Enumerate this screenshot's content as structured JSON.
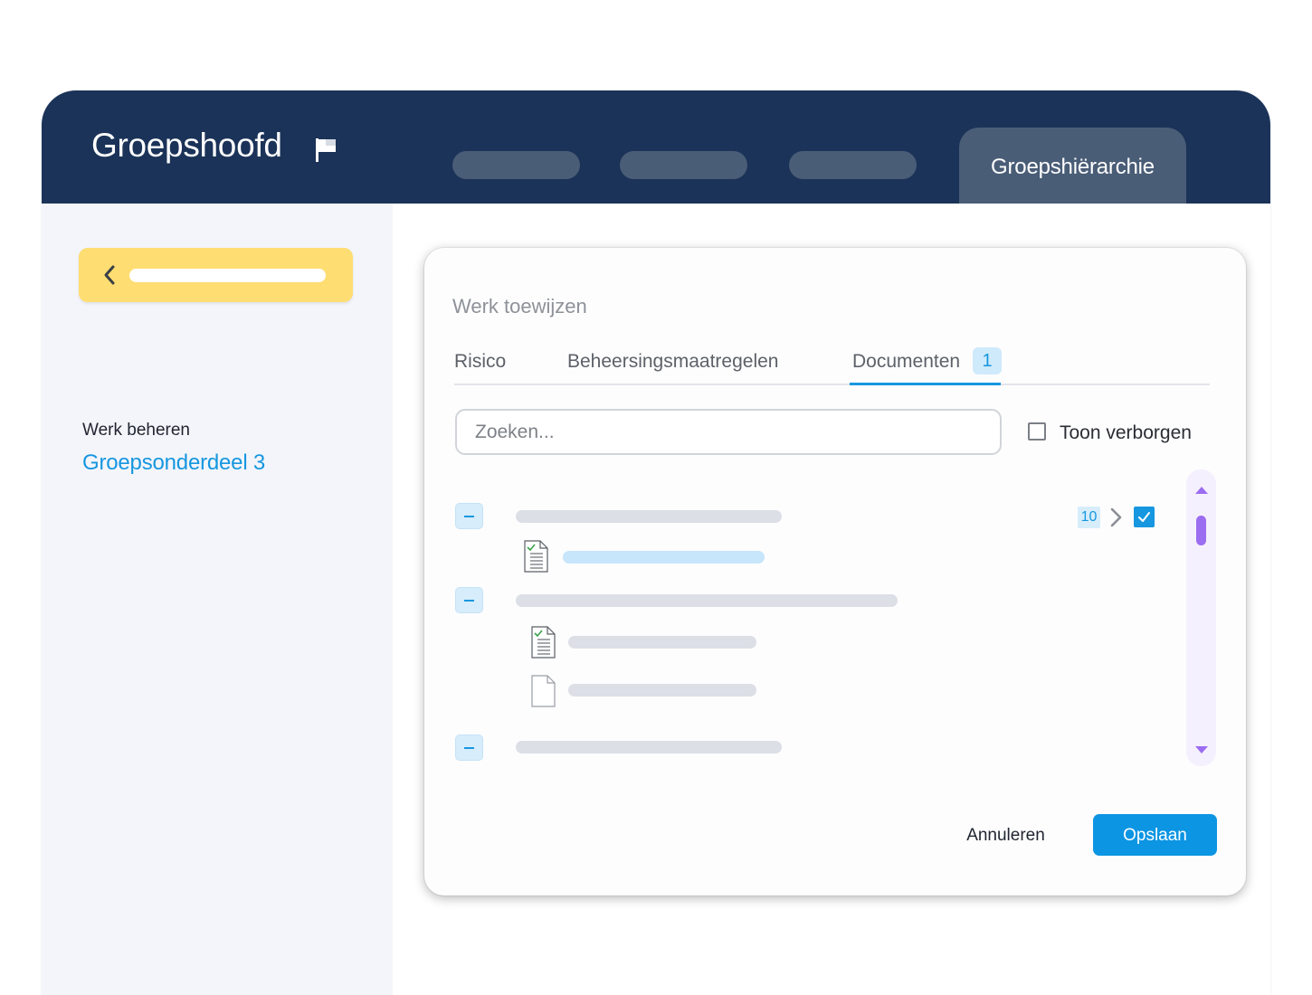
{
  "header": {
    "title": "Groepshoofd",
    "flag_icon": "flag-icon",
    "active_tab": "Groepshiërarchie"
  },
  "sidebar": {
    "back_icon": "chevron-left-icon",
    "section_heading": "Werk beheren",
    "section_link": "Groepsonderdeel 3"
  },
  "dialog": {
    "title": "Werk toewijzen",
    "tabs": [
      {
        "label": "Risico"
      },
      {
        "label": "Beheersingsmaatregelen"
      },
      {
        "label": "Documenten",
        "badge": "1",
        "active": true
      }
    ],
    "search": {
      "placeholder": "Zoeken...",
      "value": ""
    },
    "show_hidden_label": "Toon verborgen",
    "show_hidden_checked": false,
    "tree": {
      "first_row_count": "10",
      "first_row_checked": true
    },
    "cancel_label": "Annuleren",
    "save_label": "Opslaan"
  },
  "colors": {
    "header_bg": "#1b3358",
    "accent_blue": "#1697e0",
    "back_button_yellow": "#fedd72",
    "scroll_thumb_purple": "#9b6df0"
  }
}
